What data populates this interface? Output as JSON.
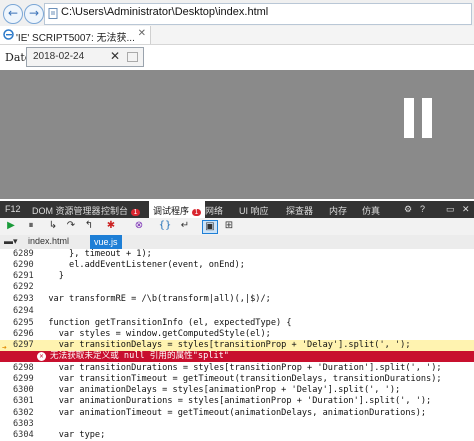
{
  "browser": {
    "back_glyph": "←",
    "forward_glyph": "→",
    "url": "C:\\Users\\Administrator\\Desktop\\index.html"
  },
  "tab": {
    "label": "'IE' SCRIPT5007: 无法获...",
    "close_glyph": "✕"
  },
  "page": {
    "date_label": "Date",
    "date_value": "2018-02-24",
    "clear_glyph": "✕"
  },
  "devtools": {
    "tabs": [
      {
        "label": "F12"
      },
      {
        "label": "DOM 资源管理器"
      },
      {
        "label": "控制台",
        "badge": "1"
      },
      {
        "label": "调试程序",
        "badge": "1"
      },
      {
        "label": "网络"
      },
      {
        "label": "UI 响应"
      },
      {
        "label": "探查器"
      },
      {
        "label": "内存"
      },
      {
        "label": "仿真"
      }
    ],
    "files": [
      "index.html",
      "vue.js"
    ],
    "code_lines": [
      {
        "n": "6289",
        "text": "}, timeout + 1);"
      },
      {
        "n": "6290",
        "text": "el.addEventListener(event, onEnd);"
      },
      {
        "n": "6291",
        "text": "}"
      },
      {
        "n": "6292",
        "text": ""
      },
      {
        "n": "6293",
        "text": "var transformRE = /\\b(transform|all)(,|$)/;"
      },
      {
        "n": "6294",
        "text": ""
      },
      {
        "n": "6295",
        "text": "function getTransitionInfo (el, expectedType) {"
      },
      {
        "n": "6296",
        "text": "  var styles = window.getComputedStyle(el);"
      },
      {
        "n": "6297",
        "text": "  var transitionDelays = styles[transitionProp + 'Delay'].split(', ');"
      },
      {
        "n": "",
        "text": "无法获取未定义或 null 引用的属性\"split\""
      },
      {
        "n": "6298",
        "text": "  var transitionDurations = styles[transitionProp + 'Duration'].split(', ');"
      },
      {
        "n": "6299",
        "text": "  var transitionTimeout = getTimeout(transitionDelays, transitionDurations);"
      },
      {
        "n": "6300",
        "text": "  var animationDelays = styles[animationProp + 'Delay'].split(', ');"
      },
      {
        "n": "6301",
        "text": "  var animationDurations = styles[animationProp + 'Duration'].split(', ');"
      },
      {
        "n": "6302",
        "text": "  var animationTimeout = getTimeout(animationDelays, animationDurations);"
      },
      {
        "n": "6303",
        "text": ""
      },
      {
        "n": "6304",
        "text": "  var type;"
      }
    ]
  }
}
